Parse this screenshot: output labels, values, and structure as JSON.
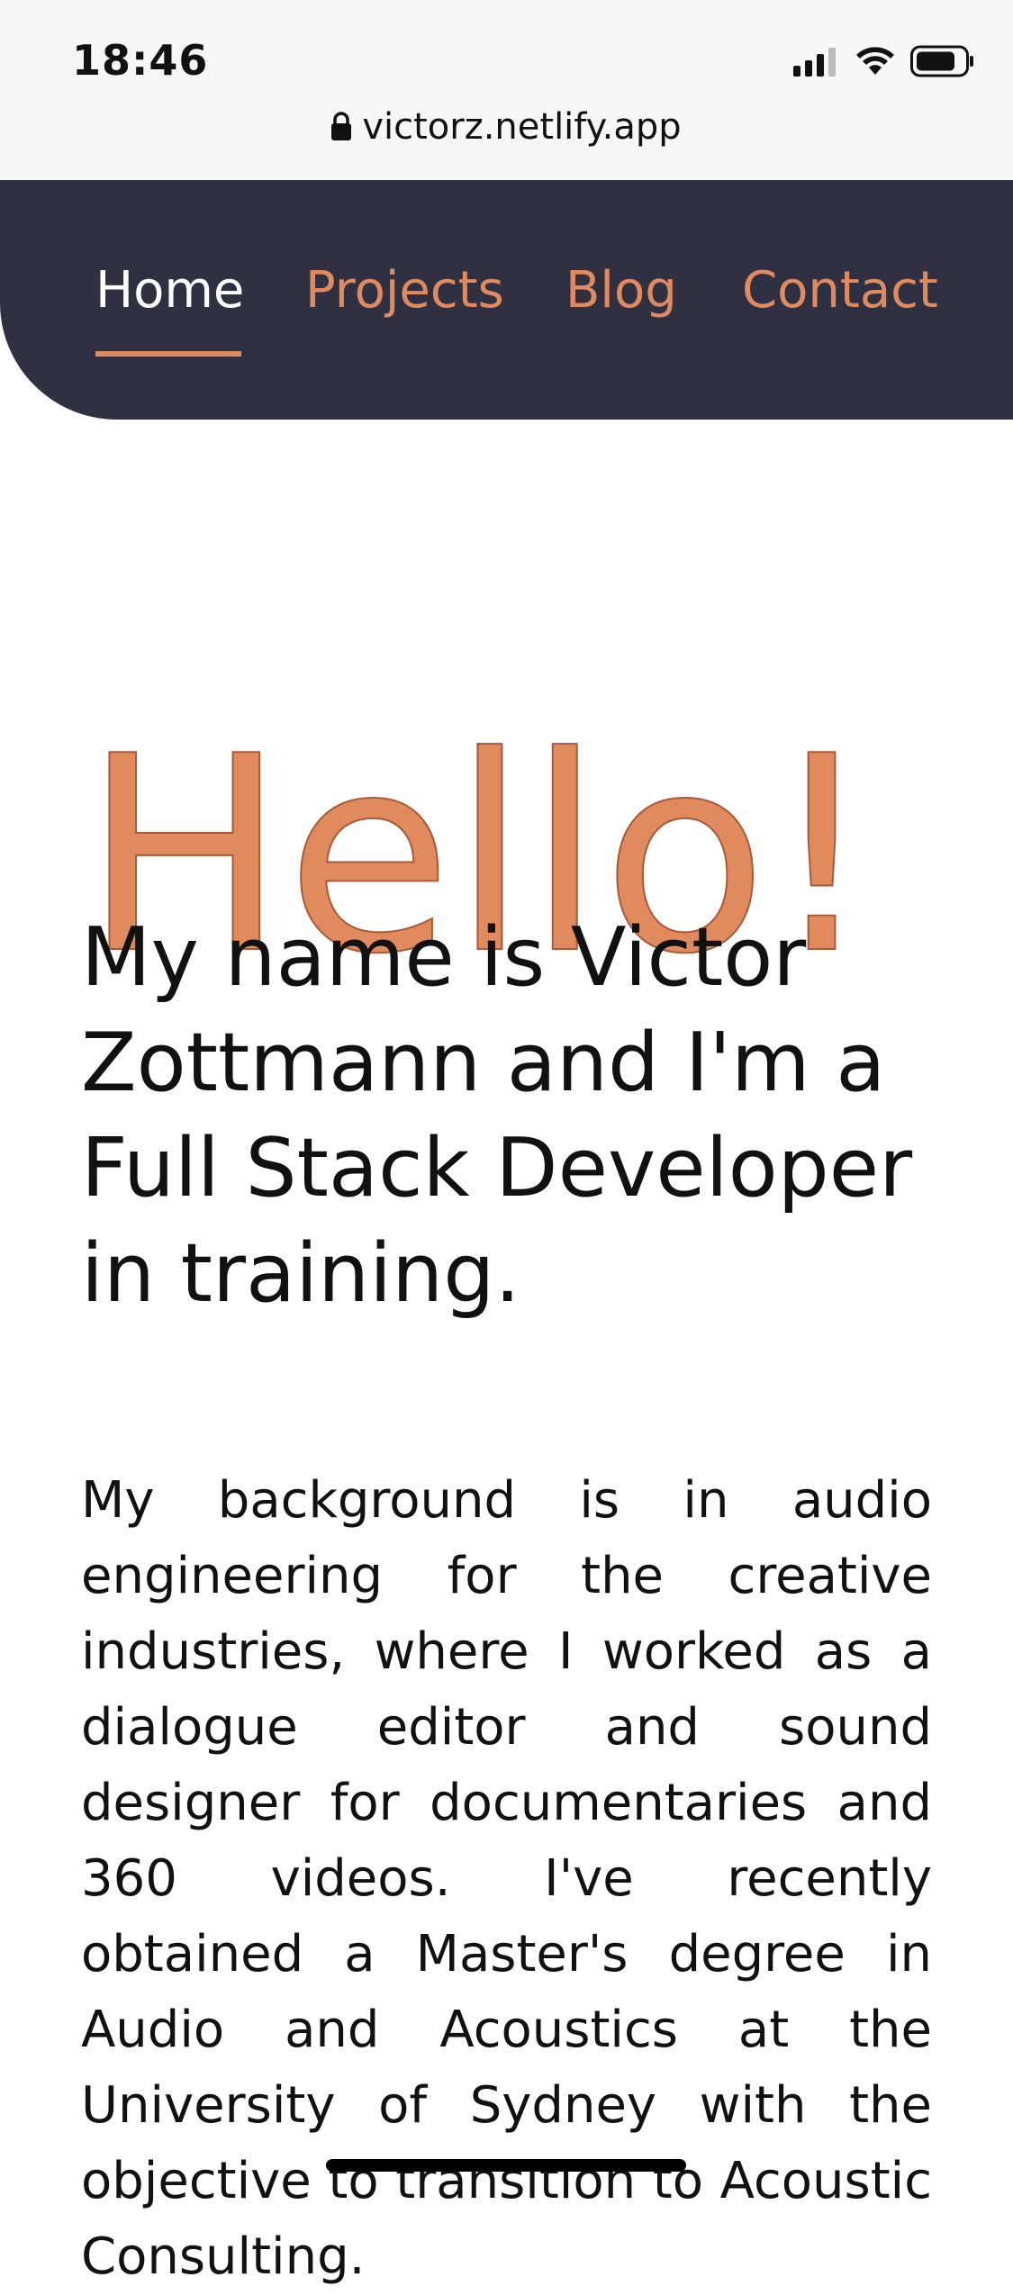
{
  "status_bar": {
    "time": "18:46",
    "url": "victorz.netlify.app"
  },
  "nav": {
    "items": [
      "Home",
      "Projects",
      "Blog",
      "Contact"
    ],
    "active": "Home"
  },
  "hero": {
    "greeting": "Hello!",
    "intro": "My name is Victor Zottmann and I'm a Full Stack Developer in training.",
    "bio": "My background is in audio engineering for the creative industries, where I worked as a dialogue editor and sound designer for documentaries and 360 videos. I've recently obtained a Master's degree in Audio and Acoustics at the University of Sydney with the objective to transition to Acoustic Consulting."
  },
  "colors": {
    "nav_bg": "#2f3142",
    "accent": "#e08a5e",
    "status_bg": "#f6f6f6"
  },
  "icons": [
    "lock-icon",
    "signal-icon",
    "wifi-icon",
    "battery-icon"
  ]
}
